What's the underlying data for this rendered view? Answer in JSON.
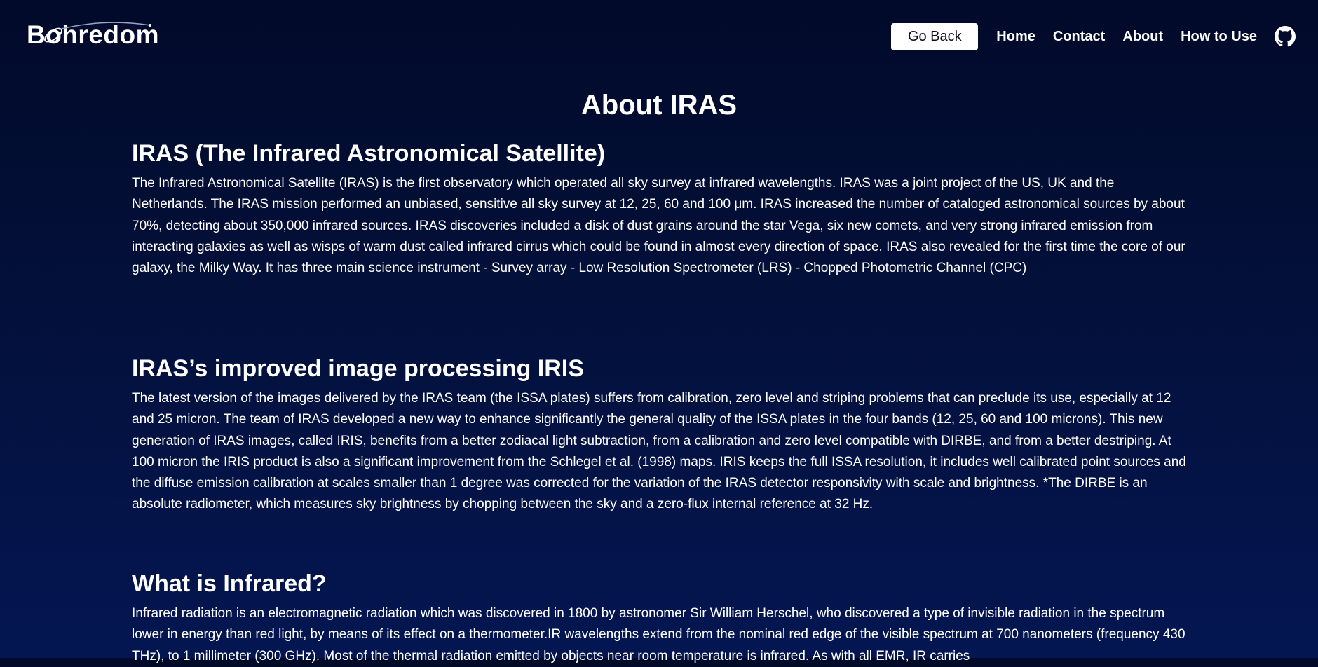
{
  "brand": {
    "logo_text": "Bohredom"
  },
  "nav": {
    "go_back_label": "Go Back",
    "links": [
      "Home",
      "Contact",
      "About",
      "How to Use"
    ],
    "github_icon": "github-icon"
  },
  "page": {
    "title": "About IRAS"
  },
  "sections": [
    {
      "heading": "IRAS (The Infrared Astronomical Satellite)",
      "body": "The Infrared Astronomical Satellite (IRAS) is the first observatory which operated all sky survey at infrared wavelengths. IRAS was a joint project of the US, UK and the Netherlands. The IRAS mission performed an unbiased, sensitive all sky survey at 12, 25, 60 and 100 μm. IRAS increased the number of cataloged astronomical sources by about 70%, detecting about 350,000 infrared sources. IRAS discoveries included a disk of dust grains around the star Vega, six new comets, and very strong infrared emission from interacting galaxies as well as wisps of warm dust called infrared cirrus which could be found in almost every direction of space. IRAS also revealed for the first time the core of our galaxy, the Milky Way. It has three main science instrument - Survey array - Low Resolution Spectrometer (LRS) - Chopped Photometric Channel (CPC)"
    },
    {
      "heading": "IRAS’s improved image processing IRIS",
      "body": "The latest version of the images delivered by the IRAS team (the ISSA plates) suffers from calibration, zero level and striping problems that can preclude its use, especially at 12 and 25 micron. The team of IRAS developed a new way to enhance significantly the general quality of the ISSA plates in the four bands (12, 25, 60 and 100 microns). This new generation of IRAS images, called IRIS, benefits from a better zodiacal light subtraction, from a calibration and zero level compatible with DIRBE, and from a better destriping. At 100 micron the IRIS product is also a significant improvement from the Schlegel et al. (1998) maps. IRIS keeps the full ISSA resolution, it includes well calibrated point sources and the diffuse emission calibration at scales smaller than 1 degree was corrected for the variation of the IRAS detector responsivity with scale and brightness. *The DIRBE is an absolute radiometer, which measures sky brightness by chopping between the sky and a zero-flux internal reference at 32 Hz."
    },
    {
      "heading": "What is Infrared?",
      "body": "Infrared radiation is an electromagnetic radiation which was discovered in 1800 by astronomer Sir William Herschel, who discovered a type of invisible radiation in the spectrum lower in energy than red light, by means of its effect on a thermometer.IR wavelengths extend from the nominal red edge of the visible spectrum at 700 nanometers (frequency 430 THz), to 1 millimeter (300 GHz). Most of the thermal radiation emitted by objects near room temperature is infrared. As with all EMR, IR carries"
    }
  ],
  "colors": {
    "background_top": "#020a2a",
    "background_bottom": "#041652",
    "text": "#ffffff",
    "button_bg": "#ffffff",
    "button_text": "#0b0b1a"
  }
}
